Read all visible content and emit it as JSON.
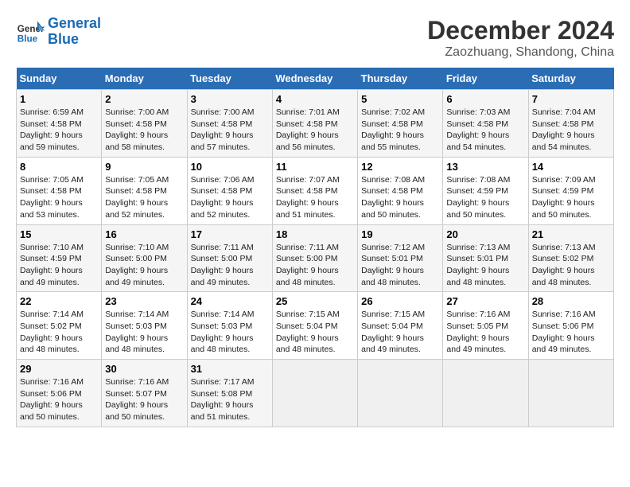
{
  "header": {
    "logo_line1": "General",
    "logo_line2": "Blue",
    "title": "December 2024",
    "subtitle": "Zaozhuang, Shandong, China"
  },
  "weekdays": [
    "Sunday",
    "Monday",
    "Tuesday",
    "Wednesday",
    "Thursday",
    "Friday",
    "Saturday"
  ],
  "weeks": [
    [
      {
        "day": "1",
        "info": "Sunrise: 6:59 AM\nSunset: 4:58 PM\nDaylight: 9 hours\nand 59 minutes."
      },
      {
        "day": "2",
        "info": "Sunrise: 7:00 AM\nSunset: 4:58 PM\nDaylight: 9 hours\nand 58 minutes."
      },
      {
        "day": "3",
        "info": "Sunrise: 7:00 AM\nSunset: 4:58 PM\nDaylight: 9 hours\nand 57 minutes."
      },
      {
        "day": "4",
        "info": "Sunrise: 7:01 AM\nSunset: 4:58 PM\nDaylight: 9 hours\nand 56 minutes."
      },
      {
        "day": "5",
        "info": "Sunrise: 7:02 AM\nSunset: 4:58 PM\nDaylight: 9 hours\nand 55 minutes."
      },
      {
        "day": "6",
        "info": "Sunrise: 7:03 AM\nSunset: 4:58 PM\nDaylight: 9 hours\nand 54 minutes."
      },
      {
        "day": "7",
        "info": "Sunrise: 7:04 AM\nSunset: 4:58 PM\nDaylight: 9 hours\nand 54 minutes."
      }
    ],
    [
      {
        "day": "8",
        "info": "Sunrise: 7:05 AM\nSunset: 4:58 PM\nDaylight: 9 hours\nand 53 minutes."
      },
      {
        "day": "9",
        "info": "Sunrise: 7:05 AM\nSunset: 4:58 PM\nDaylight: 9 hours\nand 52 minutes."
      },
      {
        "day": "10",
        "info": "Sunrise: 7:06 AM\nSunset: 4:58 PM\nDaylight: 9 hours\nand 52 minutes."
      },
      {
        "day": "11",
        "info": "Sunrise: 7:07 AM\nSunset: 4:58 PM\nDaylight: 9 hours\nand 51 minutes."
      },
      {
        "day": "12",
        "info": "Sunrise: 7:08 AM\nSunset: 4:58 PM\nDaylight: 9 hours\nand 50 minutes."
      },
      {
        "day": "13",
        "info": "Sunrise: 7:08 AM\nSunset: 4:59 PM\nDaylight: 9 hours\nand 50 minutes."
      },
      {
        "day": "14",
        "info": "Sunrise: 7:09 AM\nSunset: 4:59 PM\nDaylight: 9 hours\nand 50 minutes."
      }
    ],
    [
      {
        "day": "15",
        "info": "Sunrise: 7:10 AM\nSunset: 4:59 PM\nDaylight: 9 hours\nand 49 minutes."
      },
      {
        "day": "16",
        "info": "Sunrise: 7:10 AM\nSunset: 5:00 PM\nDaylight: 9 hours\nand 49 minutes."
      },
      {
        "day": "17",
        "info": "Sunrise: 7:11 AM\nSunset: 5:00 PM\nDaylight: 9 hours\nand 49 minutes."
      },
      {
        "day": "18",
        "info": "Sunrise: 7:11 AM\nSunset: 5:00 PM\nDaylight: 9 hours\nand 48 minutes."
      },
      {
        "day": "19",
        "info": "Sunrise: 7:12 AM\nSunset: 5:01 PM\nDaylight: 9 hours\nand 48 minutes."
      },
      {
        "day": "20",
        "info": "Sunrise: 7:13 AM\nSunset: 5:01 PM\nDaylight: 9 hours\nand 48 minutes."
      },
      {
        "day": "21",
        "info": "Sunrise: 7:13 AM\nSunset: 5:02 PM\nDaylight: 9 hours\nand 48 minutes."
      }
    ],
    [
      {
        "day": "22",
        "info": "Sunrise: 7:14 AM\nSunset: 5:02 PM\nDaylight: 9 hours\nand 48 minutes."
      },
      {
        "day": "23",
        "info": "Sunrise: 7:14 AM\nSunset: 5:03 PM\nDaylight: 9 hours\nand 48 minutes."
      },
      {
        "day": "24",
        "info": "Sunrise: 7:14 AM\nSunset: 5:03 PM\nDaylight: 9 hours\nand 48 minutes."
      },
      {
        "day": "25",
        "info": "Sunrise: 7:15 AM\nSunset: 5:04 PM\nDaylight: 9 hours\nand 48 minutes."
      },
      {
        "day": "26",
        "info": "Sunrise: 7:15 AM\nSunset: 5:04 PM\nDaylight: 9 hours\nand 49 minutes."
      },
      {
        "day": "27",
        "info": "Sunrise: 7:16 AM\nSunset: 5:05 PM\nDaylight: 9 hours\nand 49 minutes."
      },
      {
        "day": "28",
        "info": "Sunrise: 7:16 AM\nSunset: 5:06 PM\nDaylight: 9 hours\nand 49 minutes."
      }
    ],
    [
      {
        "day": "29",
        "info": "Sunrise: 7:16 AM\nSunset: 5:06 PM\nDaylight: 9 hours\nand 50 minutes."
      },
      {
        "day": "30",
        "info": "Sunrise: 7:16 AM\nSunset: 5:07 PM\nDaylight: 9 hours\nand 50 minutes."
      },
      {
        "day": "31",
        "info": "Sunrise: 7:17 AM\nSunset: 5:08 PM\nDaylight: 9 hours\nand 51 minutes."
      },
      {
        "day": "",
        "info": ""
      },
      {
        "day": "",
        "info": ""
      },
      {
        "day": "",
        "info": ""
      },
      {
        "day": "",
        "info": ""
      }
    ]
  ]
}
